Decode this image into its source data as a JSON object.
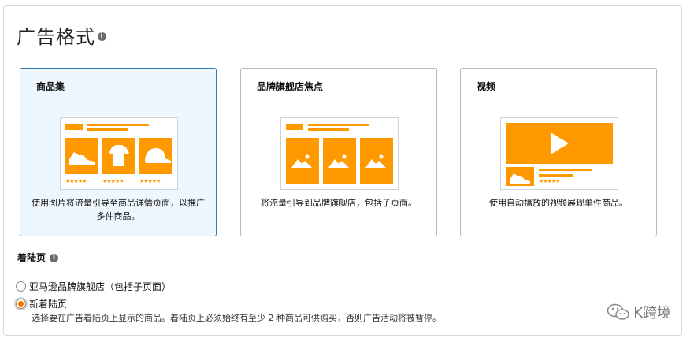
{
  "header": {
    "title": "广告格式"
  },
  "cards": [
    {
      "title": "商品集",
      "description": "使用图片将流量引导至商品详情页面，以推广多件商品。",
      "stars": "★★★★★"
    },
    {
      "title": "品牌旗舰店焦点",
      "description": "将流量引导到品牌旗舰店，包括子页面。"
    },
    {
      "title": "视频",
      "description": "使用自动播放的视频展现单件商品。",
      "stars": "★★★★★"
    }
  ],
  "landing_page": {
    "label": "着陆页",
    "options": [
      {
        "label": "亚马逊品牌旗舰店（包括子页面）",
        "checked": false
      },
      {
        "label": "新着陆页",
        "checked": true
      }
    ],
    "help": "选择要在广告着陆页上显示的商品。着陆页上必须始终有至少 2 种商品可供购买，否则广告活动将被暂停。"
  },
  "watermark": {
    "text": "K跨境"
  },
  "colors": {
    "accent": "#FF9900",
    "selected_border": "#2f7ab5",
    "selected_bg": "#eef7fd"
  },
  "icons": [
    "info-icon",
    "shoe-icon",
    "tshirt-icon",
    "cap-icon",
    "image-icon",
    "play-icon",
    "wechat-icon"
  ]
}
